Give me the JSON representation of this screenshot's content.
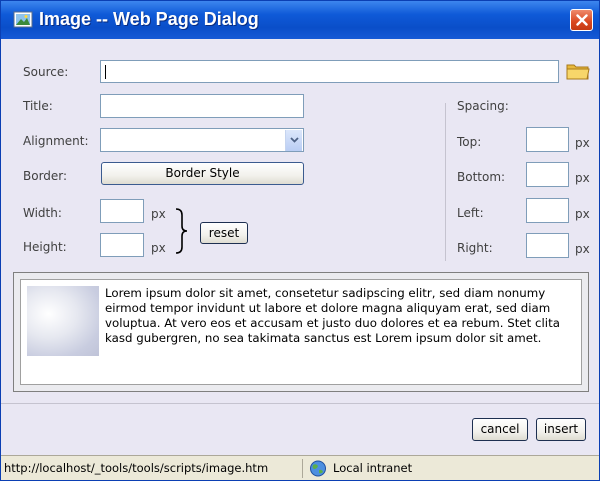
{
  "window": {
    "title": "Image -- Web Page Dialog",
    "title_icon": "picture-icon",
    "close_icon": "close-icon"
  },
  "form": {
    "source_label": "Source:",
    "source_value": "",
    "browse_icon": "folder-icon",
    "title_label": "Title:",
    "title_value": "",
    "alignment_label": "Alignment:",
    "alignment_value": "",
    "border_label": "Border:",
    "border_button": "Border Style",
    "width_label": "Width:",
    "width_value": "",
    "height_label": "Height:",
    "height_value": "",
    "unit": "px",
    "reset_button": "reset"
  },
  "spacing": {
    "heading": "Spacing:",
    "top_label": "Top:",
    "bottom_label": "Bottom:",
    "left_label": "Left:",
    "right_label": "Right:",
    "top_value": "",
    "bottom_value": "",
    "left_value": "",
    "right_value": "",
    "unit": "px"
  },
  "preview": {
    "text": "Lorem ipsum dolor sit amet, consetetur sadipscing elitr, sed diam nonumy eirmod tempor invidunt ut labore et dolore magna aliquyam erat, sed diam voluptua. At vero eos et accusam et justo duo dolores et ea rebum. Stet clita kasd gubergren, no sea takimata sanctus est Lorem ipsum dolor sit amet."
  },
  "actions": {
    "cancel": "cancel",
    "insert": "insert"
  },
  "statusbar": {
    "url": "http://localhost/_tools/tools/scripts/image.htm",
    "zone": "Local intranet",
    "zone_icon": "globe-icon"
  },
  "colors": {
    "titlebar": "#0f5ad8",
    "dialog_bg": "#e9e7f3",
    "close_button": "#d9471f"
  }
}
